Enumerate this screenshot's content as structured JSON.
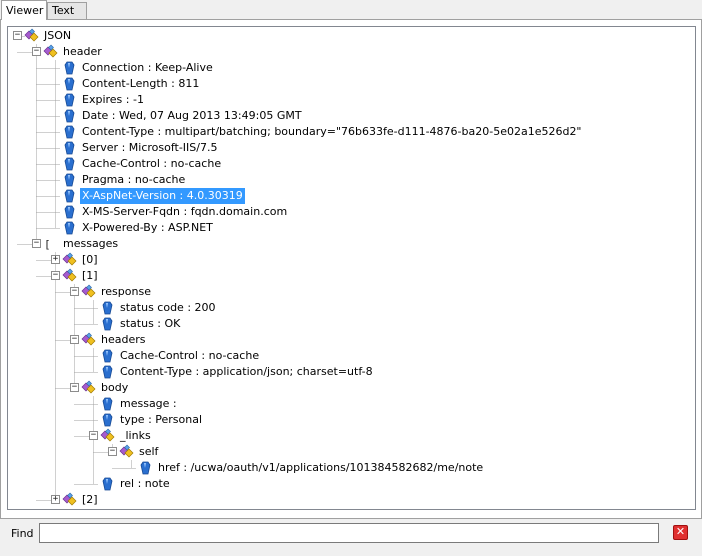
{
  "tabs": [
    {
      "label": "Viewer",
      "active": true
    },
    {
      "label": "Text",
      "active": false
    }
  ],
  "colors": {
    "selection": "#3399ff",
    "tree_line": "#a0a0a0",
    "object_icon": "#f0c020",
    "value_icon": "#2a6fcf"
  },
  "tree": [
    {
      "id": "n0",
      "label": "JSON",
      "depth": 0,
      "type": "object",
      "exp": "-",
      "row": 0
    },
    {
      "id": "n1",
      "label": "header",
      "depth": 1,
      "type": "object",
      "exp": "-",
      "row": 1
    },
    {
      "id": "n2",
      "label": "Connection : Keep-Alive",
      "depth": 2,
      "type": "value",
      "exp": "",
      "row": 2
    },
    {
      "id": "n3",
      "label": "Content-Length : 811",
      "depth": 2,
      "type": "value",
      "exp": "",
      "row": 3
    },
    {
      "id": "n4",
      "label": "Expires : -1",
      "depth": 2,
      "type": "value",
      "exp": "",
      "row": 4
    },
    {
      "id": "n5",
      "label": "Date : Wed, 07 Aug 2013 13:49:05 GMT",
      "depth": 2,
      "type": "value",
      "exp": "",
      "row": 5
    },
    {
      "id": "n6",
      "label": "Content-Type : multipart/batching; boundary=\"76b633fe-d111-4876-ba20-5e02a1e526d2\"",
      "depth": 2,
      "type": "value",
      "exp": "",
      "row": 6
    },
    {
      "id": "n7",
      "label": "Server : Microsoft-IIS/7.5",
      "depth": 2,
      "type": "value",
      "exp": "",
      "row": 7
    },
    {
      "id": "n8",
      "label": "Cache-Control : no-cache",
      "depth": 2,
      "type": "value",
      "exp": "",
      "row": 8
    },
    {
      "id": "n9",
      "label": "Pragma : no-cache",
      "depth": 2,
      "type": "value",
      "exp": "",
      "row": 9
    },
    {
      "id": "n10",
      "label": "X-AspNet-Version : 4.0.30319",
      "depth": 2,
      "type": "value",
      "exp": "",
      "row": 10,
      "selected": true
    },
    {
      "id": "n11",
      "label": "X-MS-Server-Fqdn : fqdn.domain.com",
      "depth": 2,
      "type": "value",
      "exp": "",
      "row": 11
    },
    {
      "id": "n12",
      "label": "X-Powered-By : ASP.NET",
      "depth": 2,
      "type": "value",
      "exp": "",
      "row": 12
    },
    {
      "id": "n13",
      "label": "messages",
      "depth": 1,
      "type": "array",
      "exp": "-",
      "row": 13
    },
    {
      "id": "n14",
      "label": "[0]",
      "depth": 2,
      "type": "object",
      "exp": "+",
      "row": 14
    },
    {
      "id": "n15",
      "label": "[1]",
      "depth": 2,
      "type": "object",
      "exp": "-",
      "row": 15
    },
    {
      "id": "n16",
      "label": "response",
      "depth": 3,
      "type": "object",
      "exp": "-",
      "row": 16
    },
    {
      "id": "n17",
      "label": "status code : 200",
      "depth": 4,
      "type": "value",
      "exp": "",
      "row": 17
    },
    {
      "id": "n18",
      "label": "status : OK",
      "depth": 4,
      "type": "value",
      "exp": "",
      "row": 18
    },
    {
      "id": "n19",
      "label": "headers",
      "depth": 3,
      "type": "object",
      "exp": "-",
      "row": 19
    },
    {
      "id": "n20",
      "label": "Cache-Control : no-cache",
      "depth": 4,
      "type": "value",
      "exp": "",
      "row": 20
    },
    {
      "id": "n21",
      "label": "Content-Type : application/json; charset=utf-8",
      "depth": 4,
      "type": "value",
      "exp": "",
      "row": 21
    },
    {
      "id": "n22",
      "label": "body",
      "depth": 3,
      "type": "object",
      "exp": "-",
      "row": 22
    },
    {
      "id": "n23",
      "label": "message :",
      "depth": 4,
      "type": "value",
      "exp": "",
      "row": 23
    },
    {
      "id": "n24",
      "label": "type : Personal",
      "depth": 4,
      "type": "value",
      "exp": "",
      "row": 24
    },
    {
      "id": "n25",
      "label": "_links",
      "depth": 4,
      "type": "object",
      "exp": "-",
      "row": 25
    },
    {
      "id": "n26",
      "label": "self",
      "depth": 5,
      "type": "object",
      "exp": "-",
      "row": 26
    },
    {
      "id": "n27",
      "label": "href : /ucwa/oauth/v1/applications/101384582682/me/note",
      "depth": 6,
      "type": "value",
      "exp": "",
      "row": 27
    },
    {
      "id": "n28",
      "label": "rel : note",
      "depth": 4,
      "type": "value",
      "exp": "",
      "row": 28
    },
    {
      "id": "n29",
      "label": "[2]",
      "depth": 2,
      "type": "object",
      "exp": "+",
      "row": 29
    }
  ],
  "find": {
    "label": "Find",
    "value": "",
    "placeholder": ""
  },
  "close_icon": "close-icon"
}
